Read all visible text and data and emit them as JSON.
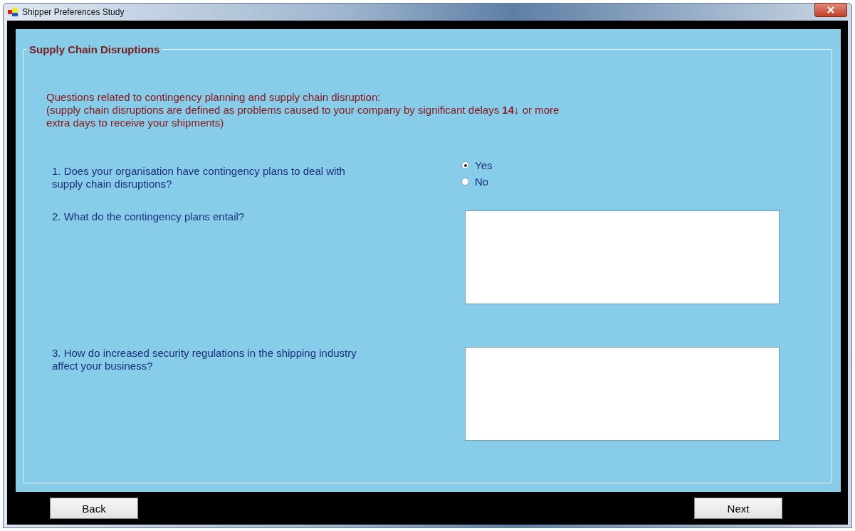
{
  "window": {
    "title": "Shipper Preferences Study"
  },
  "section": {
    "title": "Supply Chain Disruptions",
    "intro": [
      "Questions related to contingency planning and supply chain disruption:",
      "(supply chain disruptions are defined as problems caused to your company by significant delays **14**↓ or more",
      "extra days to receive your shipments)"
    ]
  },
  "questions": [
    {
      "kind": "radio",
      "text": "1. Does your organisation have contingency plans to deal with supply chain disruptions?",
      "options": [
        {
          "label": "Yes",
          "selected": true
        },
        {
          "label": "No",
          "selected": false
        }
      ]
    },
    {
      "kind": "textarea",
      "text": "2. What do the contingency plans entail?"
    },
    {
      "kind": "textarea",
      "text": "3. How do increased security regulations in the shipping industry affect your business?"
    }
  ],
  "buttons": [
    {
      "label": "Back"
    },
    {
      "label": "Next"
    }
  ]
}
